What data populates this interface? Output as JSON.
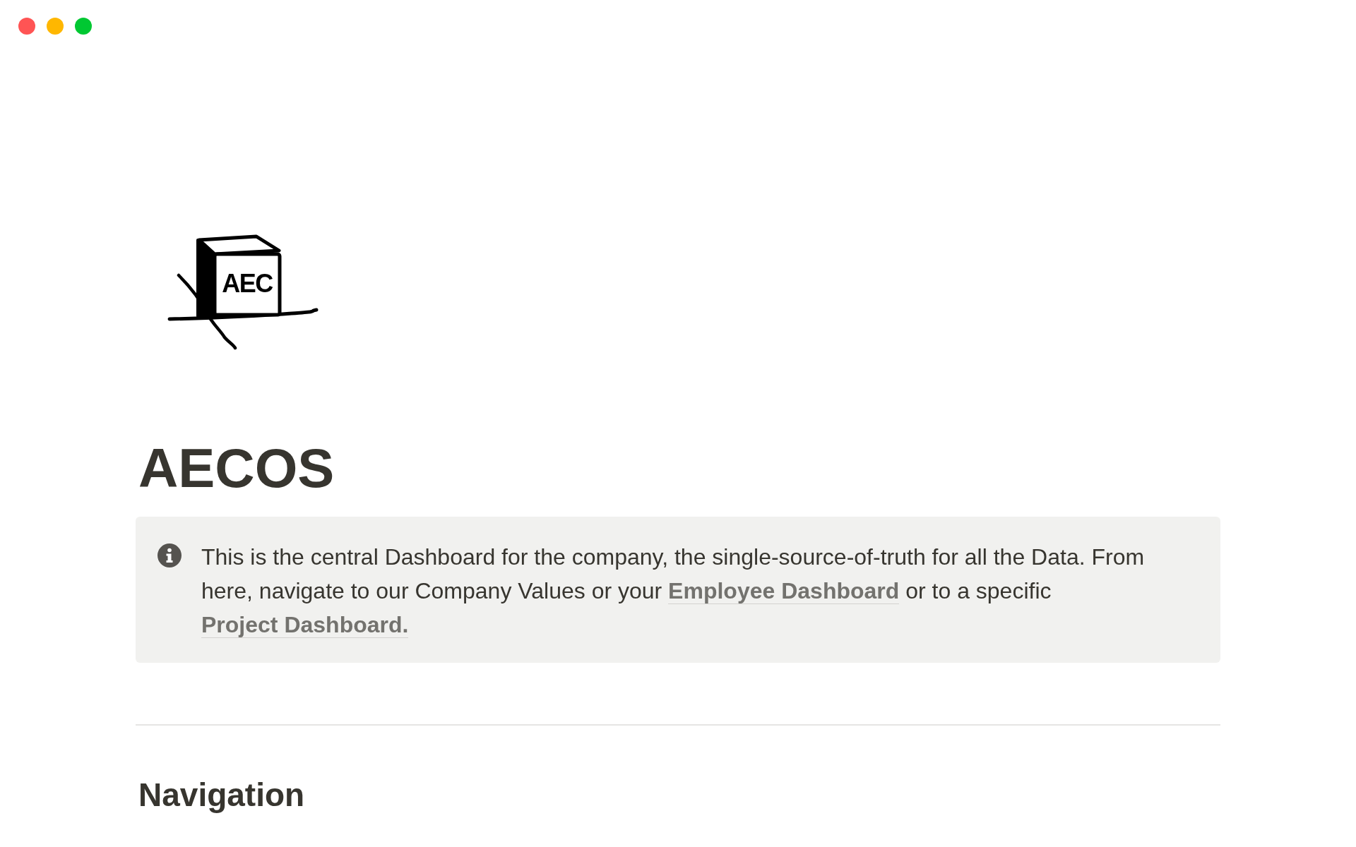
{
  "page": {
    "icon": {
      "text": "AEC"
    },
    "title": "AECOS"
  },
  "blocks": [
    {
      "kind": "callout",
      "segments": [
        {
          "kind": "text",
          "text": "This is the central Dashboard for the company, the single-source-of-truth for all the Data. From here, navigate to our Company Values or your "
        },
        {
          "kind": "link",
          "text": "Employee Dashboard"
        },
        {
          "kind": "text",
          "text": " or to a specific "
        },
        {
          "kind": "link",
          "text": "Project Dashboard."
        }
      ]
    },
    {
      "kind": "divider"
    },
    {
      "kind": "heading",
      "text": "Navigation"
    }
  ]
}
